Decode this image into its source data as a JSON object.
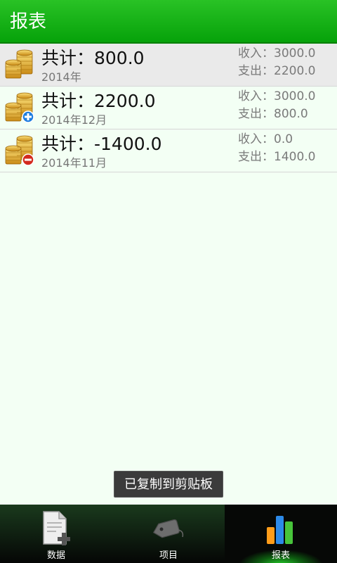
{
  "header": {
    "title": "报表"
  },
  "reports": [
    {
      "total": "共计：800.0",
      "period": "2014年",
      "income": "收入：3000.0",
      "expense": "支出：2200.0",
      "icon": "coins-icon"
    },
    {
      "total": "共计：2200.0",
      "period": "2014年12月",
      "income": "收入：3000.0",
      "expense": "支出：800.0",
      "icon": "coins-plus-icon"
    },
    {
      "total": "共计：-1400.0",
      "period": "2014年11月",
      "income": "收入：0.0",
      "expense": "支出：1400.0",
      "icon": "coins-minus-icon"
    }
  ],
  "toast": {
    "text": "已复制到剪贴板"
  },
  "bottom_nav": {
    "tabs": [
      {
        "label": "数据",
        "icon": "document-add-icon"
      },
      {
        "label": "项目",
        "icon": "tag-icon"
      },
      {
        "label": "报表",
        "icon": "bar-chart-icon",
        "active": true
      }
    ]
  },
  "colors": {
    "header": "#0aa50d",
    "accent": "#29d42d",
    "background": "#f3fff4"
  }
}
